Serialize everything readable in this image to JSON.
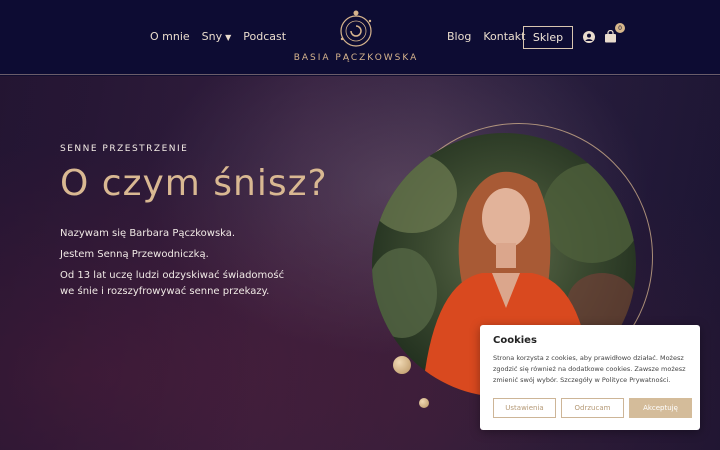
{
  "header": {
    "nav_left": [
      "O mnie",
      "Sny",
      "Podcast"
    ],
    "nav_right": [
      "Blog",
      "Kontakt"
    ],
    "shop_label": "Sklep",
    "cart_count": "0",
    "brand": "BASIA PĄCZKOWSKA"
  },
  "hero": {
    "eyebrow": "SENNE PRZESTRZENIE",
    "headline": "O czym śnisz?",
    "lines": [
      "Nazywam się Barbara Pączkowska.",
      "Jestem Senną Przewodniczką.",
      "Od 13 lat uczę ludzi odzyskiwać świadomość we śnie i rozszyfrowywać senne przekazy."
    ]
  },
  "cookie": {
    "title": "Cookies",
    "text": "Strona korzysta z cookies, aby prawidłowo działać. Możesz zgodzić się również na dodatkowe cookies. Zawsze możesz zmienić swój wybór. Szczegóły w Polityce Prywatności.",
    "settings": "Ustawienia",
    "reject": "Odrzucam",
    "accept": "Akceptuję"
  },
  "colors": {
    "navy": "#0d0c33",
    "gold": "#d6b48d",
    "accept_btn": "#d4bc9a"
  }
}
